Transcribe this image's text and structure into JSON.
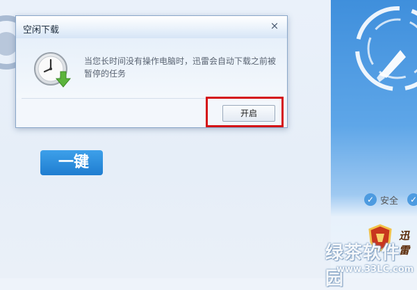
{
  "dialog": {
    "title": "空闲下载",
    "close_glyph": "×",
    "message": "当您长时间没有操作电脑时，迅雷会自动下载之前被暂停的任务",
    "start_button": "开启"
  },
  "background": {
    "one_key_label": "一键",
    "safe_items": [
      "安全",
      ""
    ],
    "check_glyph": "✓",
    "logo_text": "迅雷",
    "watermark": "绿茶软件园",
    "watermark_url": "www.33LC.com"
  },
  "colors": {
    "highlight": "#d40d12",
    "panel_blue": "#3f8fdc",
    "button_blue": "#1f7dd0"
  },
  "icons": {
    "clock": "clock-download-icon",
    "close": "close-icon",
    "check": "check-icon",
    "shield": "shield-logo-icon"
  }
}
